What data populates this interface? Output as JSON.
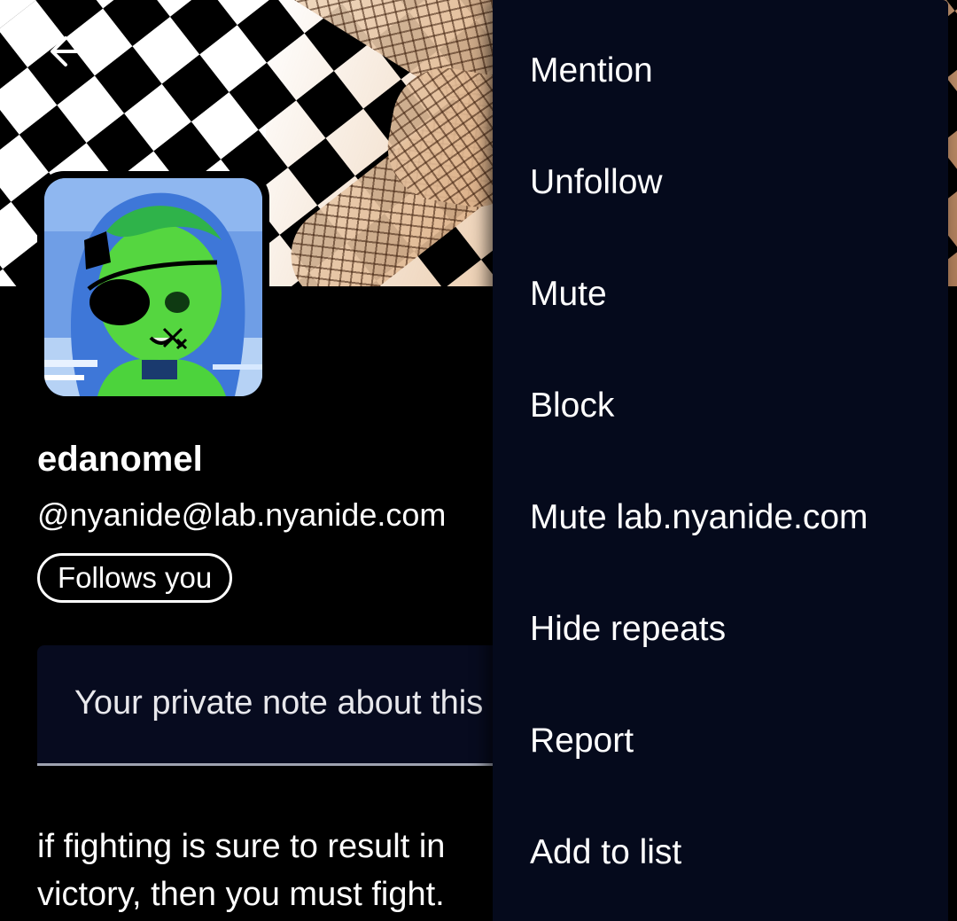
{
  "header": {
    "back_icon": "arrow-left-icon"
  },
  "profile": {
    "display_name": "edanomel",
    "handle": "@nyanide@lab.nyanide.com",
    "follows_badge": "Follows you",
    "note_placeholder": "Your private note about this account",
    "bio": "if fighting is sure to result in victory, then you must fight."
  },
  "menu": {
    "items": [
      {
        "label": "Mention"
      },
      {
        "label": "Unfollow"
      },
      {
        "label": "Mute"
      },
      {
        "label": "Block"
      },
      {
        "label": "Mute lab.nyanide.com"
      },
      {
        "label": "Hide repeats"
      },
      {
        "label": "Report"
      },
      {
        "label": "Add to list"
      }
    ]
  },
  "colors": {
    "background": "#000000",
    "menu_background": "#050a1c",
    "note_background": "#070b1f",
    "text": "#ffffff"
  }
}
